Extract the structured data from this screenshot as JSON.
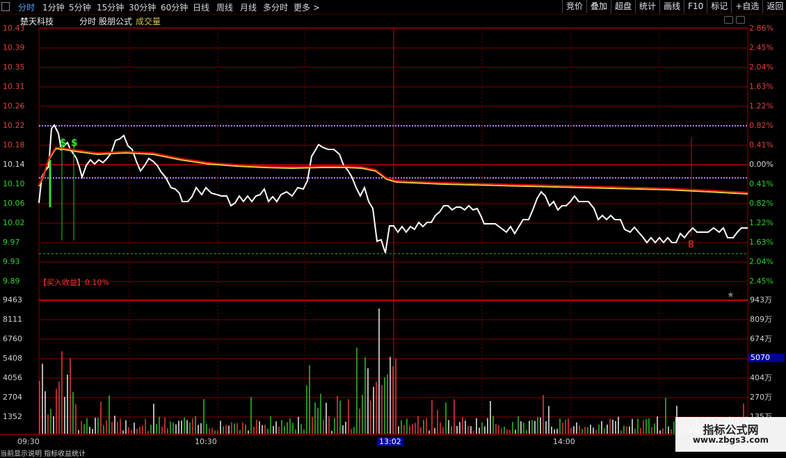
{
  "toolbar": {
    "tabs": [
      "分时",
      "1分钟",
      "5分钟",
      "15分钟",
      "30分钟",
      "60分钟",
      "日线",
      "周线",
      "月线",
      "多分时",
      "更多 >"
    ],
    "right_buttons": [
      "竞价",
      "叠加",
      "超盘",
      "统计",
      "画线",
      "F10",
      "标记",
      "+自选",
      "返回"
    ]
  },
  "title": {
    "stock_name": "楚天科技",
    "mode": "分时",
    "formula": "股朋公式",
    "indicator": "成交量"
  },
  "price_axis": {
    "left": [
      "10.43",
      "10.39",
      "10.35",
      "10.31",
      "10.26",
      "10.22",
      "10.18",
      "10.14",
      "10.10",
      "10.06",
      "10.02",
      "9.97",
      "9.93",
      "9.89"
    ],
    "right": [
      "2.86%",
      "2.45%",
      "2.04%",
      "1.63%",
      "1.22%",
      "0.82%",
      "0.41%",
      "0.00%",
      "0.41%",
      "0.82%",
      "1.22%",
      "1.63%",
      "2.04%",
      "2.45%"
    ]
  },
  "volume_axis": {
    "left": [
      "9463",
      "8111",
      "6760",
      "5408",
      "4056",
      "2704",
      "1352"
    ],
    "right": [
      "943万",
      "809万",
      "674万",
      "5070",
      "404万",
      "270万",
      "135万"
    ],
    "highlight_value": "5070"
  },
  "time_axis": [
    "09:30",
    "10:30",
    "13:02",
    "14:00"
  ],
  "annotations": {
    "buy_profit": "【买入收益】0.10%",
    "buy_marker": "B",
    "sell_marker_1": "$",
    "sell_marker_2": "$"
  },
  "watermark": {
    "line1": "指标公式网",
    "line2": "www.zbgs3.com"
  },
  "bottom_text": "当前显示说明 指标收益统计"
}
